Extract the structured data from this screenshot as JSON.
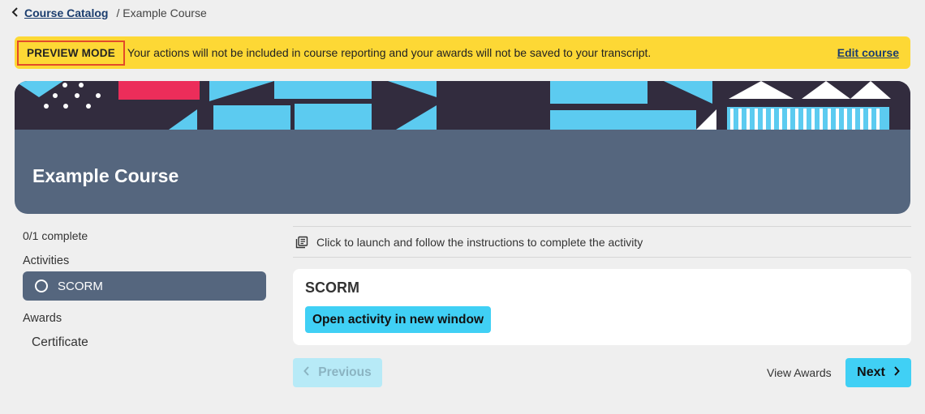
{
  "breadcrumb": {
    "back_icon": "chevron-left-icon",
    "catalog_label": "Course Catalog",
    "current": "/ Example Course"
  },
  "banner": {
    "mode_label": "PREVIEW MODE",
    "message": "Your actions will not be included in course reporting and your awards will not be saved to your transcript.",
    "edit_label": "Edit course",
    "background_color": "#fdd835",
    "highlight_color": "#e34a2a"
  },
  "hero": {
    "title": "Example Course",
    "colors": {
      "dark": "#322c3e",
      "blue": "#5ccbf0",
      "pink": "#ec2d5a",
      "panel": "#55667e"
    }
  },
  "sidebar": {
    "progress": "0/1 complete",
    "activities_label": "Activities",
    "activities": [
      {
        "label": "SCORM",
        "icon": "circle-outline-icon",
        "selected": true
      }
    ],
    "awards_label": "Awards",
    "awards": [
      "Certificate"
    ]
  },
  "main": {
    "instruction_icon": "launch-library-icon",
    "instruction": "Click to launch and follow the instructions to complete the activity",
    "activity_title": "SCORM",
    "open_label": "Open activity in new window",
    "accent_color": "#40d0f5"
  },
  "footer": {
    "previous_label": "Previous",
    "view_awards_label": "View Awards",
    "next_label": "Next"
  }
}
